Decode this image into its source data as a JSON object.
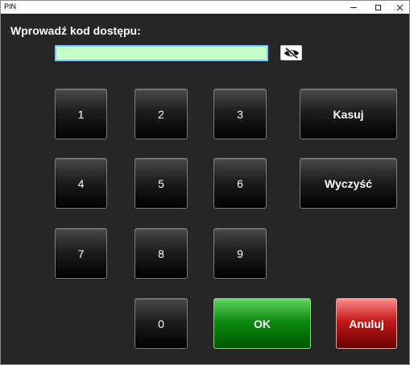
{
  "window": {
    "title": "PIN"
  },
  "prompt": {
    "label": "Wprowadź kod dostępu:"
  },
  "pin": {
    "value": ""
  },
  "keypad": {
    "k1": "1",
    "k2": "2",
    "k3": "3",
    "k4": "4",
    "k5": "5",
    "k6": "6",
    "k7": "7",
    "k8": "8",
    "k9": "9",
    "k0": "0"
  },
  "actions": {
    "delete_label": "Kasuj",
    "clear_label": "Wyczyść",
    "ok_label": "OK",
    "cancel_label": "Anuluj"
  },
  "icons": {
    "toggle_visibility": "eye-slash-icon"
  },
  "colors": {
    "background": "#262626",
    "input_fill": "#c9ffc9",
    "input_border": "#7fc8ff",
    "ok": "#0f8a0f",
    "cancel": "#c31a1a"
  }
}
